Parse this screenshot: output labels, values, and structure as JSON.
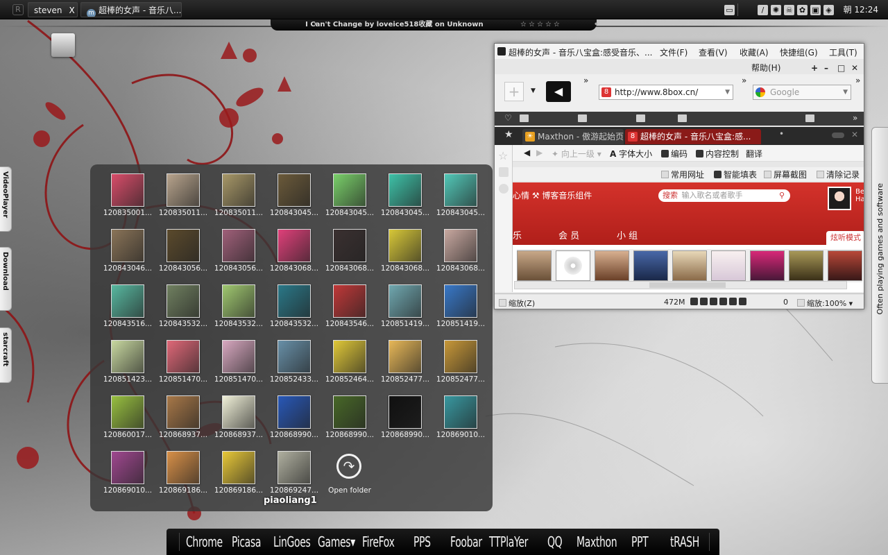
{
  "panel": {
    "tasks": [
      {
        "label": "steven",
        "close": "X"
      },
      {
        "label": "超棒的女声 - 音乐八..."
      }
    ],
    "clock": "朝 12:24"
  },
  "now_playing": {
    "title": "I Can't Change by loveice518收藏 on Unknown",
    "stars": "☆☆☆☆☆"
  },
  "side_tabs": {
    "left": [
      "VideoPlayer",
      "Download",
      "starcraft"
    ],
    "right": "Often playing games and software"
  },
  "stack": {
    "name": "piaoliang1",
    "items": [
      {
        "label": "120835001...",
        "color": "#d94d6a"
      },
      {
        "label": "120835011...",
        "color": "#b8a48d"
      },
      {
        "label": "120835011...",
        "color": "#a89868"
      },
      {
        "label": "120843045...",
        "color": "#6b5a3a"
      },
      {
        "label": "120843045...",
        "color": "#7ad06a"
      },
      {
        "label": "120843045...",
        "color": "#3ec2a8"
      },
      {
        "label": "120843045...",
        "color": "#52c8b8"
      },
      {
        "label": "120843046...",
        "color": "#8a7458"
      },
      {
        "label": "120843056...",
        "color": "#5b4a2c"
      },
      {
        "label": "120843056...",
        "color": "#a0607a"
      },
      {
        "label": "120843068...",
        "color": "#e0407a"
      },
      {
        "label": "120843068...",
        "color": "#3a3030"
      },
      {
        "label": "120843068...",
        "color": "#d8c838"
      },
      {
        "label": "120843068...",
        "color": "#c8a8a0"
      },
      {
        "label": "120843516...",
        "color": "#58b8a0"
      },
      {
        "label": "120843532...",
        "color": "#708060"
      },
      {
        "label": "120843532...",
        "color": "#a0c870"
      },
      {
        "label": "120843532...",
        "color": "#2a7888"
      },
      {
        "label": "120843546...",
        "color": "#c03838"
      },
      {
        "label": "120851419...",
        "color": "#70a8b0"
      },
      {
        "label": "120851419...",
        "color": "#3878c8"
      },
      {
        "label": "120851423...",
        "color": "#c8d8a0"
      },
      {
        "label": "120851470...",
        "color": "#e06878"
      },
      {
        "label": "120851470...",
        "color": "#d8a8c0"
      },
      {
        "label": "120852433...",
        "color": "#6890a8"
      },
      {
        "label": "120852464...",
        "color": "#e0c838"
      },
      {
        "label": "120852477...",
        "color": "#e8b858"
      },
      {
        "label": "120852477...",
        "color": "#c89838"
      },
      {
        "label": "120860017...",
        "color": "#98c040"
      },
      {
        "label": "120868937...",
        "color": "#a87848"
      },
      {
        "label": "120868937...",
        "color": "#f0f0d8"
      },
      {
        "label": "120868990...",
        "color": "#2858b8"
      },
      {
        "label": "120868990...",
        "color": "#486828"
      },
      {
        "label": "120868990...",
        "color": "#101010"
      },
      {
        "label": "120869010...",
        "color": "#3898a0"
      },
      {
        "label": "120869010...",
        "color": "#a04890"
      },
      {
        "label": "120869186...",
        "color": "#d89048"
      },
      {
        "label": "120869186...",
        "color": "#e8c838"
      },
      {
        "label": "120869247...",
        "color": "#b0b0a0"
      }
    ],
    "open_folder": "Open folder"
  },
  "browser": {
    "title": "超棒的女声 - 音乐八宝盒:感受音乐、...",
    "menu": [
      "文件(F)",
      "查看(V)",
      "收藏(A)",
      "快捷组(G)",
      "工具(T)",
      "帮助(H)"
    ],
    "win_ctrls": [
      "+",
      "–",
      "□",
      "✕"
    ],
    "address": "http://www.8box.cn/",
    "search_placeholder": "Google",
    "tabs": [
      "Maxthon - 傲游起始页",
      "超棒的女声 - 音乐八宝盒:感..."
    ],
    "nav2": [
      "向上一级",
      "字体大小",
      "编码",
      "内容控制",
      "翻译"
    ],
    "nav3": [
      "常用网址",
      "智能填表",
      "屏幕截图",
      "清除记录"
    ],
    "page": {
      "title": "心情 ⚒ 博客音乐组件",
      "search_label": "搜索",
      "search_placeholder": "输入歌名或者歌手",
      "nav": [
        "乐",
        "会 员",
        "小 组"
      ],
      "listen_mode": "炫听模式",
      "avatar_text": "Be Ha"
    },
    "status": {
      "zoom_label": "缩放(Z)",
      "memory": "472M",
      "count": "0",
      "zoom_value": "缩放:100%"
    }
  },
  "dock": {
    "items": [
      "Chrome",
      "Picasa",
      "LinGoes",
      "Games▾",
      "FireFox",
      "PPS",
      "Foobar",
      "TTPlaYer",
      "QQ",
      "Maxthon",
      "PPT",
      "tRASH"
    ]
  }
}
